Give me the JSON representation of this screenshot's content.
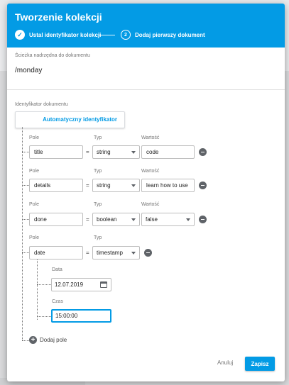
{
  "header": {
    "title": "Tworzenie kolekcji",
    "step1_label": "Ustal identyfikator kolekcji",
    "step2_number": "2",
    "step2_label": "Dodaj pierwszy dokument",
    "color": "#039be5"
  },
  "parent_path": {
    "label": "Ścieżka nadrzędna do dokumentu",
    "value": "/monday"
  },
  "doc_id": {
    "label": "Identyfikator dokumentu",
    "auto_button": "Automatyczny identyfikator"
  },
  "field_headers": {
    "pole": "Pole",
    "typ": "Typ",
    "wartosc": "Wartość",
    "equals": "="
  },
  "fields": [
    {
      "name": "title",
      "type": "string",
      "value": "code"
    },
    {
      "name": "details",
      "type": "string",
      "value": "learn how to use"
    },
    {
      "name": "done",
      "type": "boolean",
      "value": "false"
    },
    {
      "name": "date",
      "type": "timestamp"
    }
  ],
  "timestamp": {
    "date_label": "Data",
    "date_value": "12.07.2019",
    "time_label": "Czas",
    "time_value": "15:00:00"
  },
  "add_field": "Dodaj pole",
  "footer": {
    "cancel": "Anuluj",
    "save": "Zapisz"
  }
}
